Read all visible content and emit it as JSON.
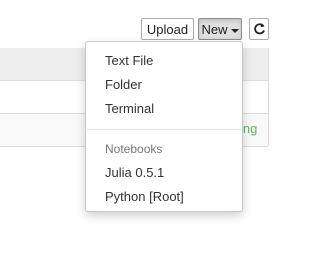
{
  "toolbar": {
    "upload_label": "Upload",
    "new_label": "New",
    "refresh_icon": "refresh-icon"
  },
  "file_list": {
    "status_partial": "ing",
    "status_color": "#5cb85c"
  },
  "new_menu": {
    "items": [
      {
        "label": "Text File"
      },
      {
        "label": "Folder"
      },
      {
        "label": "Terminal"
      }
    ],
    "notebooks_header": "Notebooks",
    "notebooks": [
      {
        "label": "Julia 0.5.1"
      },
      {
        "label": "Python [Root]"
      }
    ]
  }
}
